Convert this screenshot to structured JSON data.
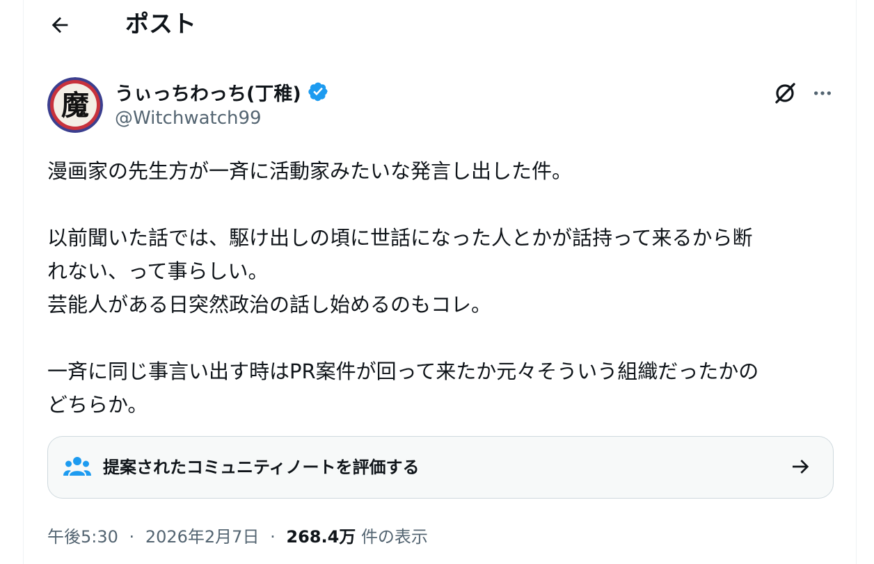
{
  "header": {
    "title": "ポスト",
    "back_icon": "arrow-left-icon"
  },
  "author": {
    "name": "うぃっちわっち(丁稚)",
    "handle": "@Witchwatch99",
    "verified": true,
    "verified_color": "#1d9bf0",
    "avatar_char": "魔",
    "avatar_colors": {
      "ring": "#3b3f8f",
      "ring_accent": "#c8323c",
      "face": "#f4efe6",
      "glyph": "#111111"
    }
  },
  "actions": {
    "grok_icon": "grok-icon",
    "more_icon": "more-horizontal-icon"
  },
  "post": {
    "paragraph_1": "漫画家の先生方が一斉に活動家みたいな発言し出した件。",
    "paragraph_2_line_1": "以前聞いた話では、駆け出しの頃に世話になった人とかが話持って来るから断",
    "paragraph_2_line_2": "れない、って事らしい。",
    "paragraph_2_line_3": "芸能人がある日突然政治の話し始めるのもコレ。",
    "paragraph_3_line_1": "一斉に同じ事言い出す時はPR案件が回って来たか元々そういう組織だったかの",
    "paragraph_3_line_2": "どちらか。"
  },
  "community_note": {
    "label": "提案されたコミュニティノートを評価する",
    "icon": "people-icon",
    "icon_color": "#1d9bf0",
    "arrow_icon": "arrow-right-icon"
  },
  "meta": {
    "time": "午後5:30",
    "separator": "·",
    "date": "2026年2月7日",
    "views_count": "268.4万",
    "views_label": "件の表示"
  }
}
